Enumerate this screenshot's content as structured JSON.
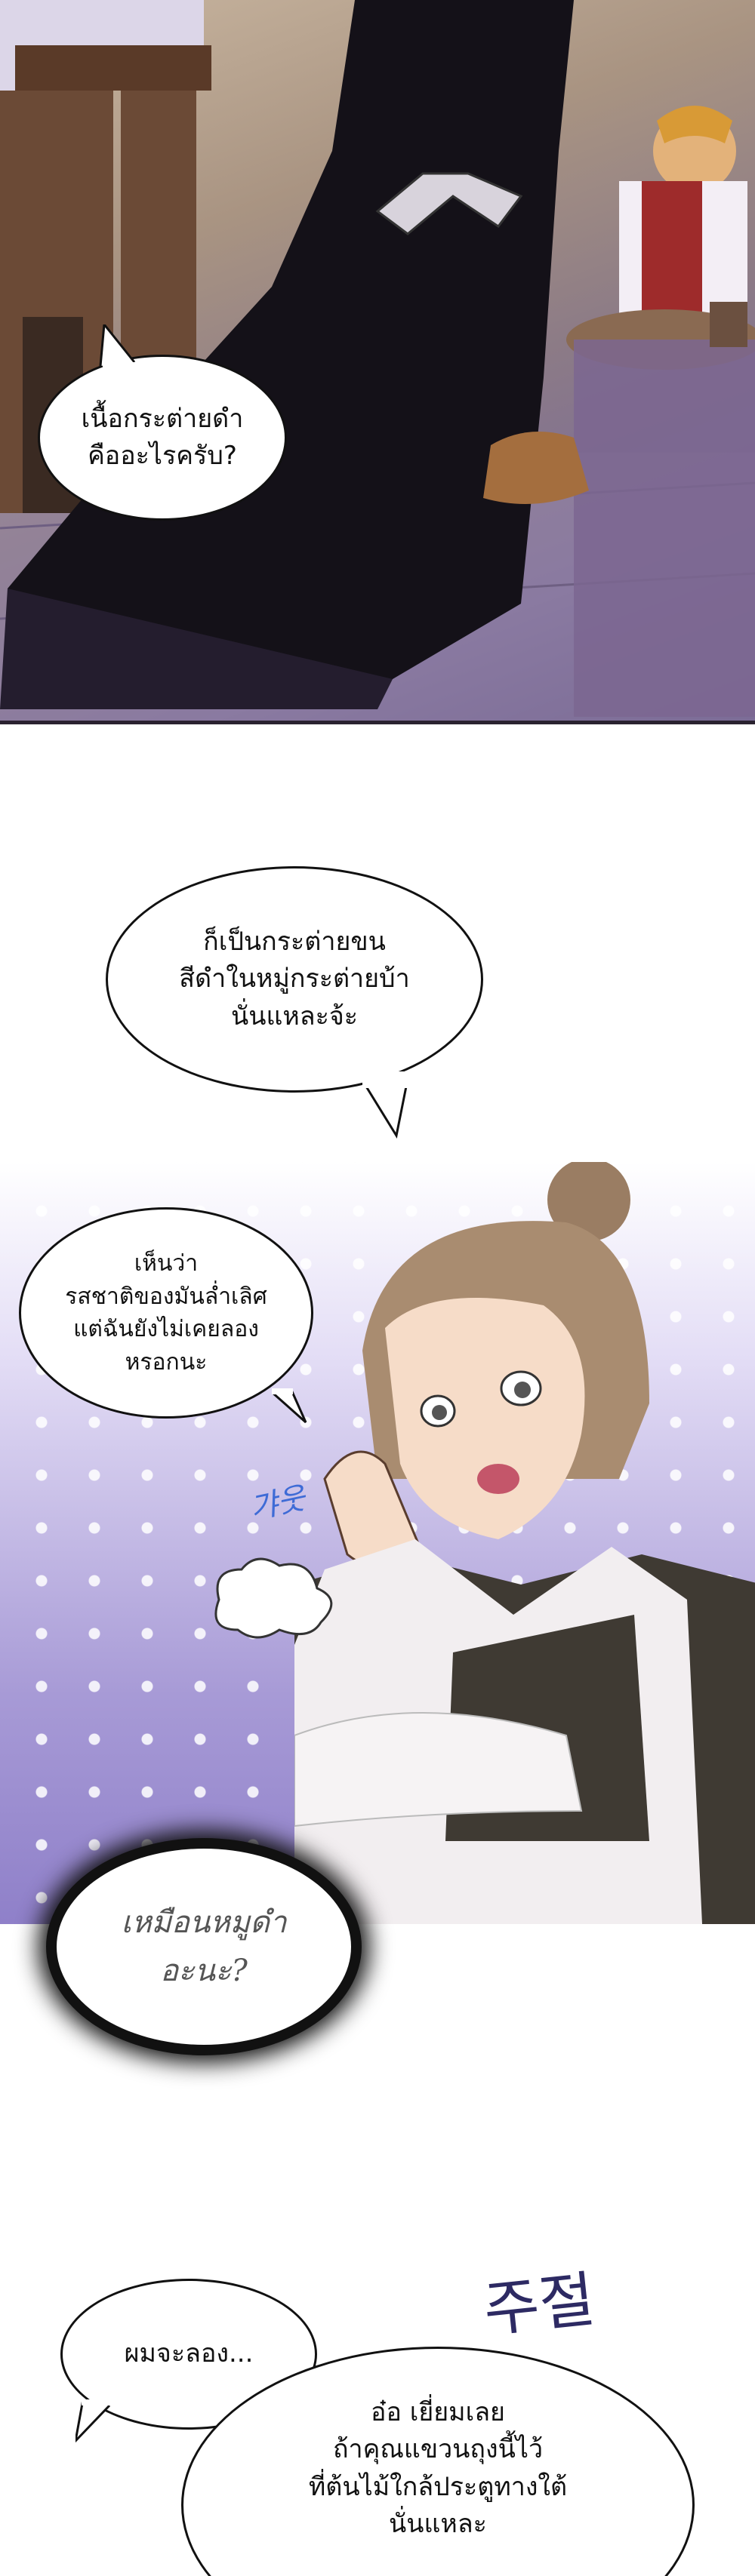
{
  "panel1": {
    "bubble_text": "เนื้อกระต่ายดำ\nคืออะไรครับ?"
  },
  "panel2": {
    "bubble_top_text": "ก็เป็นกระต่ายขน\nสีดำในหมู่กระต่ายบ้า\nนั่นแหละจ้ะ",
    "bubble_left_text": "เห็นว่า\nรสชาติของมันล่ำเลิศ\nแต่ฉันยังไม่เคยลอง\nหรอกนะ",
    "sfx_text": "갸웃",
    "dark_bubble_text": "เหมือนหมูดำ\nอะนะ?"
  },
  "panel3": {
    "sfx_text": "주절",
    "bubble_left_text": "ผมจะลอง...",
    "bubble_right_text": "อ๋อ เยี่ยมเลย\nถ้าคุณแขวนถุงนี้ไว้\nที่ต้นไม้ใกล้ประตูทางใต้\nนั่นแหละ"
  },
  "colors": {
    "panel1_bg": "#8c7b86",
    "panel2_bg": "#a79ad6",
    "sfx_blue": "#3e6bd6",
    "sfx_purple": "#2d2a63"
  }
}
